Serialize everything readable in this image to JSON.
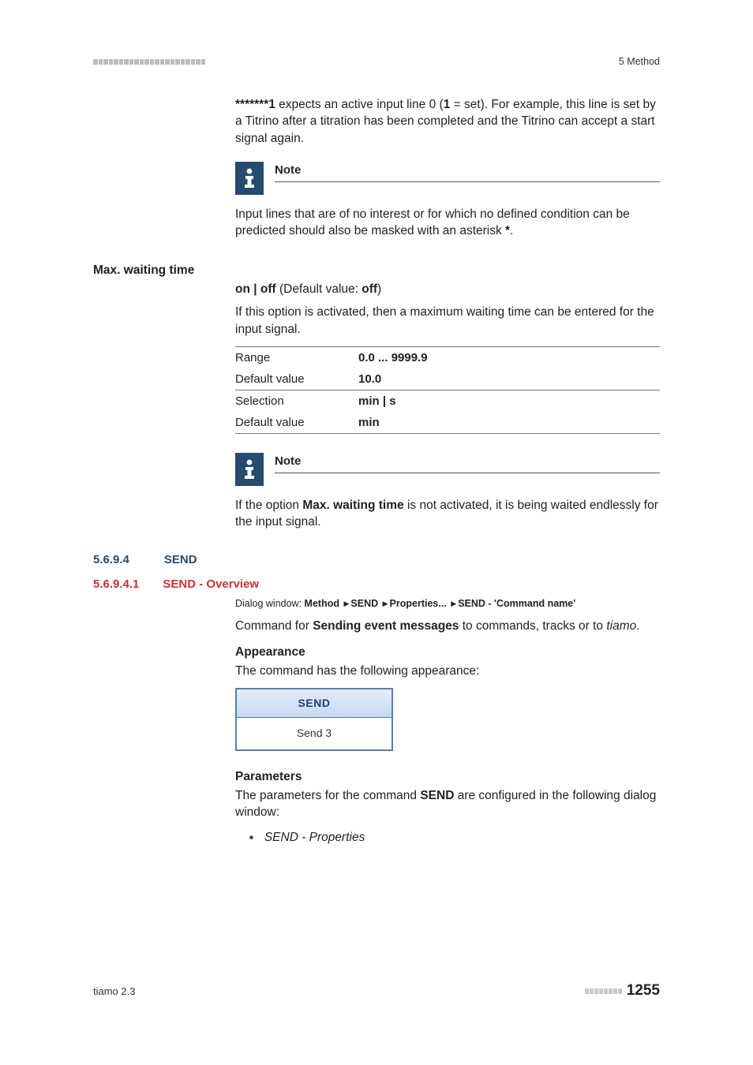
{
  "header": {
    "chapter": "5 Method"
  },
  "intro": {
    "prefix": "*******1",
    "text1": " expects an active input line 0 (",
    "one": "1",
    "text2": " = set). For example, this line is set by a Titrino after a titration has been completed and the Titrino can accept a start signal again."
  },
  "note1": {
    "title": "Note",
    "body1": "Input lines that are of no interest or for which no defined condition can be predicted should also be masked with an asterisk ",
    "asterisk": "*",
    "body2": "."
  },
  "maxwait": {
    "heading": "Max. waiting time",
    "options_prefix": "on | off",
    "default_text": " (Default value: ",
    "default_val": "off",
    "default_text2": ")",
    "desc": "If this option is activated, then a maximum waiting time can be entered for the input signal.",
    "table": {
      "range_label": "Range",
      "range_value": "0.0 ... 9999.9",
      "default1_label": "Default value",
      "default1_value": "10.0",
      "selection_label": "Selection",
      "selection_value": "min | s",
      "default2_label": "Default value",
      "default2_value": "min"
    }
  },
  "note2": {
    "title": "Note",
    "body1": "If the option ",
    "boldpart": "Max. waiting time",
    "body2": " is not activated, it is being waited endlessly for the input signal."
  },
  "sec_send": {
    "num": "5.6.9.4",
    "title": "SEND"
  },
  "sec_send_overview": {
    "num": "5.6.9.4.1",
    "title": "SEND - Overview"
  },
  "dialog": {
    "prefix": "Dialog window: ",
    "p1": "Method",
    "p2": "SEND",
    "p3": "Properties...",
    "p4": "SEND - 'Command name'"
  },
  "command": {
    "t1": "Command for ",
    "bold": "Sending event messages",
    "t2": " to commands, tracks or to ",
    "italic": "tiamo",
    "t3": "."
  },
  "appearance": {
    "head": "Appearance",
    "desc": "The command has the following appearance:",
    "widget_top": "SEND",
    "widget_bottom": "Send 3"
  },
  "parameters": {
    "head": "Parameters",
    "desc1": "The parameters for the command ",
    "bold": "SEND",
    "desc2": " are configured in the following dialog window:",
    "item1": "SEND - Properties"
  },
  "footer": {
    "product": "tiamo 2.3",
    "page": "1255"
  }
}
